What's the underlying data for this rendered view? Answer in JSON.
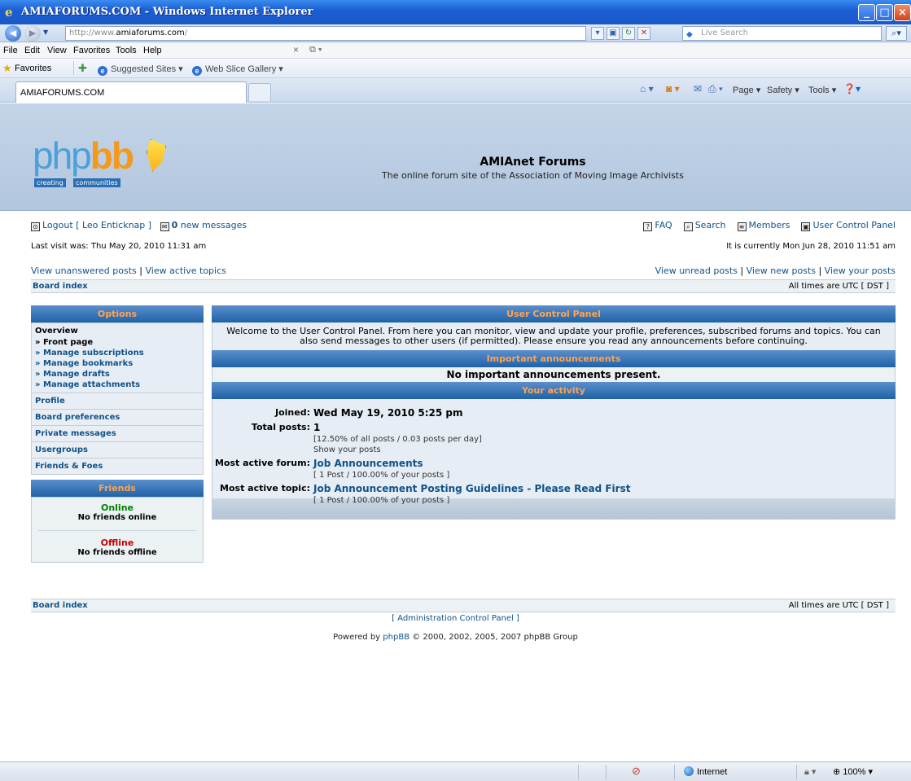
{
  "window": {
    "title": "AMIAFORUMS.COM - Windows Internet Explorer",
    "address_scheme": "http://www.",
    "address_host": "amiaforums.com",
    "address_path": "/",
    "live_search_placeholder": "Live Search"
  },
  "menu": [
    "File",
    "Edit",
    "View",
    "Favorites",
    "Tools",
    "Help"
  ],
  "favorites": {
    "label": "Favorites",
    "suggested": "Suggested Sites ▾",
    "webslice": "Web Slice Gallery ▾"
  },
  "tab": {
    "label": "AMIAFORUMS.COM"
  },
  "commandbar": {
    "page": "Page ▾",
    "safety": "Safety ▾",
    "tools": "Tools ▾"
  },
  "site": {
    "title": "AMIAnet Forums",
    "description": "The online forum site of the Association of Moving Image Archivists",
    "logo_tag1": "creating",
    "logo_tag2": "communities"
  },
  "userbar": {
    "logout": "Logout [ Leo Enticknap ]",
    "new_count": "0",
    "new_messages": "new messages",
    "faq": "FAQ",
    "search": "Search",
    "members": "Members",
    "ucp": "User Control Panel"
  },
  "visit": {
    "last": "Last visit was: Thu May 20, 2010 11:31 am",
    "current": "It is currently Mon Jun 28, 2010 11:51 am"
  },
  "quicklinks": {
    "unanswered": "View unanswered posts",
    "active": "View active topics",
    "unread": "View unread posts",
    "new": "View new posts",
    "your": "View your posts",
    "sep": "|"
  },
  "navstrip": {
    "board_index": "Board index",
    "timezone": "All times are UTC [ DST ]"
  },
  "sidebar": {
    "options_title": "Options",
    "overview": "Overview",
    "subitems": [
      "» Front page",
      "» Manage subscriptions",
      "» Manage bookmarks",
      "» Manage drafts",
      "» Manage attachments"
    ],
    "sections": [
      "Profile",
      "Board preferences",
      "Private messages",
      "Usergroups",
      "Friends & Foes"
    ],
    "friends_title": "Friends",
    "online_label": "Online",
    "online_msg": "No friends online",
    "offline_label": "Offline",
    "offline_msg": "No friends offline"
  },
  "main": {
    "ucp_title": "User Control Panel",
    "welcome": "Welcome to the User Control Panel. From here you can monitor, view and update your profile, preferences, subscribed forums and topics. You can also send messages to other users (if permitted). Please ensure you read any announcements before continuing.",
    "announcements_title": "Important announcements",
    "no_announcements": "No important announcements present.",
    "activity_title": "Your activity",
    "joined_label": "Joined:",
    "joined_value": "Wed May 19, 2010 5:25 pm",
    "posts_label": "Total posts:",
    "posts_value": "1",
    "posts_detail": "[12.50% of all posts / 0.03 posts per day]",
    "show_posts": "Show your posts",
    "forum_label": "Most active forum:",
    "forum_value": "Job Announcements",
    "forum_detail": "[ 1 Post / 100.00% of your posts ]",
    "topic_label": "Most active topic:",
    "topic_value": "Job Announcement Posting Guidelines - Please Read First",
    "topic_detail": "[ 1 Post / 100.00% of your posts ]"
  },
  "footer": {
    "admin": "[ Administration Control Panel ]",
    "powered_prefix": "Powered by",
    "powered_link": "phpBB",
    "powered_suffix": "© 2000, 2002, 2005, 2007 phpBB Group"
  },
  "status": {
    "zone": "Internet",
    "zoom": "100%"
  }
}
